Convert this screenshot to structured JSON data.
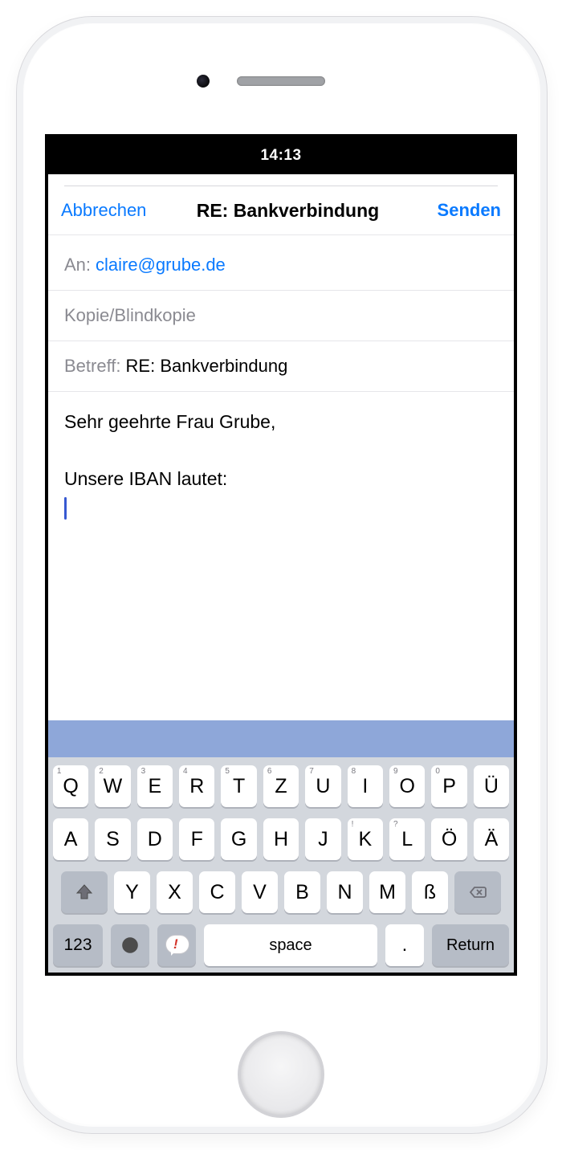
{
  "status": {
    "time": "14:13"
  },
  "nav": {
    "cancel": "Abbrechen",
    "title": "RE: Bankverbindung",
    "send": "Senden"
  },
  "fields": {
    "to_label": "An:",
    "to_value": "claire@grube.de",
    "ccbcc_label": "Kopie/Blindkopie",
    "subject_label": "Betreff:",
    "subject_value": "RE: Bankverbindung"
  },
  "body": {
    "line1": "Sehr geehrte Frau Grube,",
    "blank": " ",
    "line2": "Unsere IBAN lautet:"
  },
  "keyboard": {
    "row1": [
      {
        "k": "Q",
        "h": "1"
      },
      {
        "k": "W",
        "h": "2"
      },
      {
        "k": "E",
        "h": "3"
      },
      {
        "k": "R",
        "h": "4"
      },
      {
        "k": "T",
        "h": "5"
      },
      {
        "k": "Z",
        "h": "6"
      },
      {
        "k": "U",
        "h": "7"
      },
      {
        "k": "I",
        "h": "8"
      },
      {
        "k": "O",
        "h": "9"
      },
      {
        "k": "P",
        "h": "0"
      },
      {
        "k": "Ü",
        "h": ""
      }
    ],
    "row2": [
      {
        "k": "A"
      },
      {
        "k": "S"
      },
      {
        "k": "D"
      },
      {
        "k": "F"
      },
      {
        "k": "G"
      },
      {
        "k": "H"
      },
      {
        "k": "J"
      },
      {
        "k": "K",
        "h": "!"
      },
      {
        "k": "L",
        "h": "?"
      },
      {
        "k": "Ö"
      },
      {
        "k": "Ä"
      }
    ],
    "row3": [
      {
        "k": "Y"
      },
      {
        "k": "X"
      },
      {
        "k": "C"
      },
      {
        "k": "V"
      },
      {
        "k": "B"
      },
      {
        "k": "N"
      },
      {
        "k": "M"
      },
      {
        "k": "ß"
      }
    ],
    "row4": {
      "numbers": "123",
      "space": "space",
      "period": ".",
      "return": "Return"
    }
  }
}
